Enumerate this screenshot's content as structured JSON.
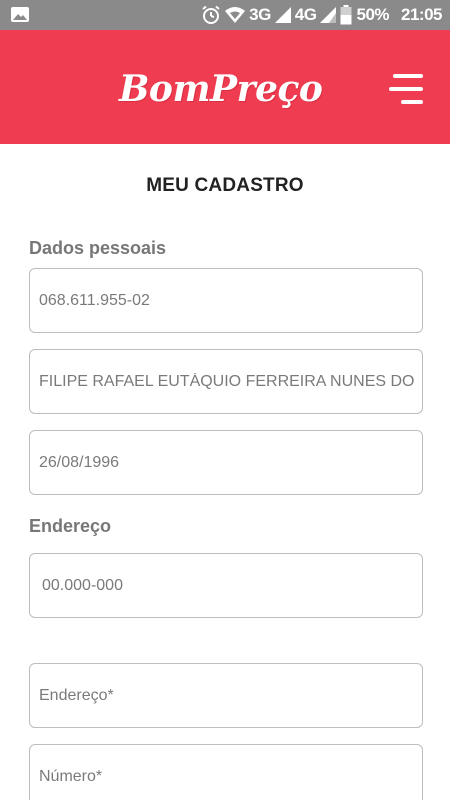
{
  "status_bar": {
    "network_3g": "3G",
    "network_4g": "4G",
    "battery": "50%",
    "time": "21:05"
  },
  "header": {
    "logo_text": "BomPreço"
  },
  "page": {
    "title": "MEU CADASTRO"
  },
  "personal": {
    "section_label": "Dados pessoais",
    "cpf": "068.611.955-02",
    "name": "FILIPE RAFAEL EUTÁQUIO FERREIRA NUNES DO",
    "birthdate": "26/08/1996"
  },
  "address": {
    "section_label": "Endereço",
    "cep_placeholder": "00.000-000",
    "street_placeholder": "Endereço*",
    "number_placeholder": "Número*"
  },
  "colors": {
    "header_bg": "#ef3c50",
    "status_bar_bg": "#8a8a8a"
  }
}
